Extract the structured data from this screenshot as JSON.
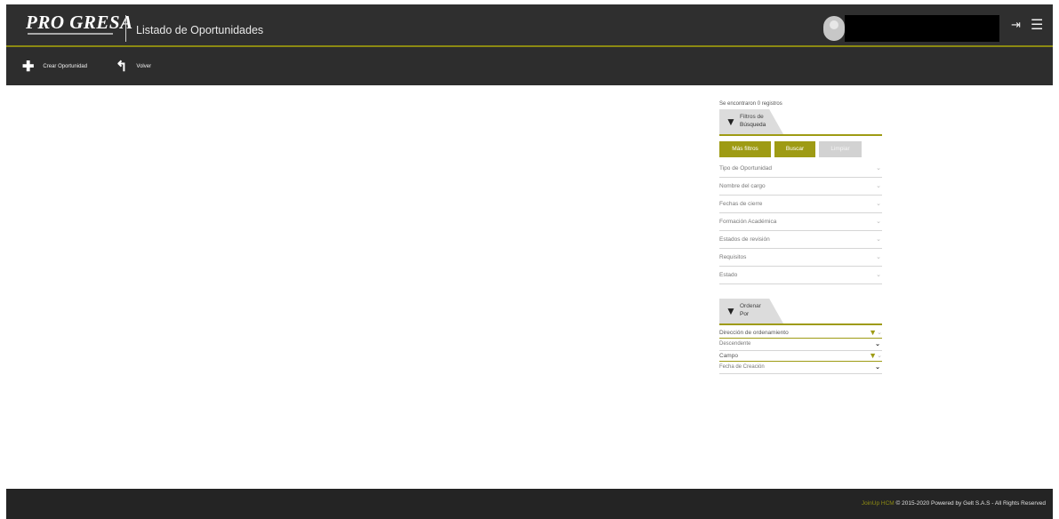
{
  "header": {
    "logo_text": "PRO GRESA",
    "page_title": "Listado de Oportunidades"
  },
  "toolbar": {
    "create_label": "Crear Oportunidad",
    "back_label": "Volver"
  },
  "panel": {
    "results_count": "Se encontraron 0 registros",
    "filters_tab": {
      "line1": "Filtros de",
      "line2": "Búsqueda"
    },
    "buttons": {
      "more_filters": "Más filtros",
      "search": "Buscar",
      "clear": "Limpiar"
    },
    "filters": [
      "Tipo de Oportunidad",
      "Nombre del cargo",
      "Fechas de cierre",
      "Formación Académica",
      "Estados de revisión",
      "Requisitos",
      "Estado"
    ],
    "order_tab": {
      "line1": "Ordenar",
      "line2": "Por"
    },
    "order_direction_label": "Dirección de ordenamiento",
    "order_direction_value": "Descendente",
    "order_field_label": "Campo",
    "order_field_value": "Fecha de Creación"
  },
  "footer": {
    "brand": "JoinUp HCM",
    "rest": "© 2015-2020 Powered by Gelt S.A.S   -   All Rights Reserved"
  },
  "colors": {
    "accent": "#9e9b14",
    "topbar": "#2f2f2f",
    "footer": "#242424"
  }
}
